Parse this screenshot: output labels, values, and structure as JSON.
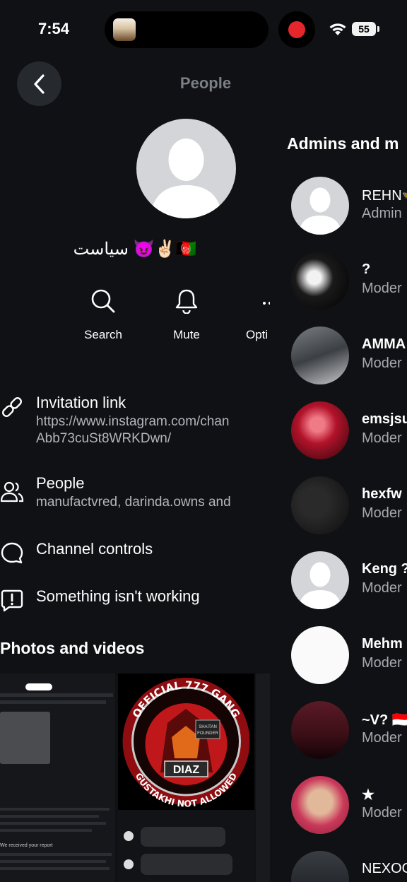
{
  "status": {
    "time": "7:54",
    "battery": "55"
  },
  "header": {
    "title": "People"
  },
  "channel": {
    "name": "سیاست 😈✌🏻🇦🇫"
  },
  "actions": [
    {
      "label": "Search",
      "icon": "search-icon"
    },
    {
      "label": "Mute",
      "icon": "bell-icon"
    },
    {
      "label": "Opti",
      "icon": "more-icon"
    }
  ],
  "rows": {
    "invitation": {
      "title": "Invitation link",
      "line1": "https://www.instagram.com/chan",
      "line2": "Abb73cuSt8WRKDwn/"
    },
    "people": {
      "title": "People",
      "subtitle": "manufactvred, darinda.owns and"
    },
    "controls": {
      "title": "Channel controls"
    },
    "problem": {
      "title": "Something isn't working"
    }
  },
  "photos": {
    "title": "Photos and videos",
    "thumb_gang": {
      "line1": "OFFICIAL 777 GANG",
      "line2": "DIAZ",
      "line3": "GUSTAKHI NOT ALLOWED",
      "badge1": "SHAITAN",
      "badge2": "FOUNDER"
    },
    "thumb_chat": {
      "header": "We received your report"
    }
  },
  "admins": {
    "title": "Admins and m",
    "members": [
      {
        "name": "REHN🦋",
        "role": "Admin"
      },
      {
        "name": "?",
        "role": "Moder"
      },
      {
        "name": "AMMA",
        "role": "Moder"
      },
      {
        "name": "emsjsu",
        "role": "Moder"
      },
      {
        "name": "hexfw",
        "role": "Moder"
      },
      {
        "name": "Keng ?",
        "role": "Moder"
      },
      {
        "name": "Mehm",
        "role": "Moder"
      },
      {
        "name": "~V? 🇮🇩",
        "role": "Moder"
      },
      {
        "name": "★",
        "role": "Moder"
      },
      {
        "name": "NEXOO",
        "role": ""
      }
    ]
  },
  "colors": {
    "background": "#0f1114",
    "muted": "#b3b6bb",
    "record": "#e5262b"
  }
}
